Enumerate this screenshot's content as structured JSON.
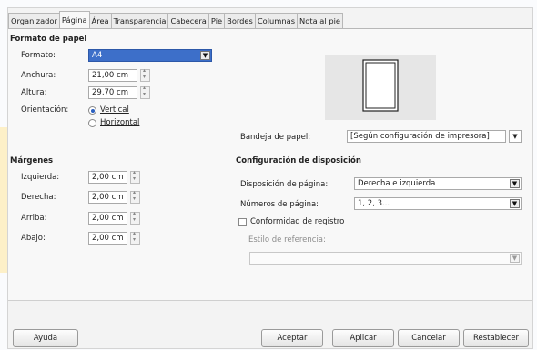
{
  "tabs": [
    "Organizador",
    "Página",
    "Área",
    "Transparencia",
    "Cabecera",
    "Pie",
    "Bordes",
    "Columnas",
    "Nota al pie"
  ],
  "active_tab": "Página",
  "paper": {
    "section_title": "Formato de papel",
    "format_label": "Formato:",
    "format_value": "A4",
    "width_label": "Anchura:",
    "width_value": "21,00 cm",
    "height_label": "Altura:",
    "height_value": "29,70 cm",
    "orientation_label": "Orientación:",
    "vertical_label": "Vertical",
    "horizontal_label": "Horizontal",
    "orientation_selected": "Vertical",
    "tray_label": "Bandeja de papel:",
    "tray_value": "[Según configuración de impresora]"
  },
  "margins": {
    "section_title": "Márgenes",
    "left_label": "Izquierda:",
    "left_value": "2,00 cm",
    "right_label": "Derecha:",
    "right_value": "2,00 cm",
    "top_label": "Arriba:",
    "top_value": "2,00 cm",
    "bottom_label": "Abajo:",
    "bottom_value": "2,00 cm"
  },
  "layout": {
    "section_title": "Configuración de disposición",
    "page_layout_label": "Disposición de página:",
    "page_layout_value": "Derecha e izquierda",
    "page_numbers_label": "Números de página:",
    "page_numbers_value": "1, 2, 3...",
    "register_label": "Conformidad de registro",
    "register_checked": false,
    "reference_style_label": "Estilo de referencia:",
    "reference_style_value": ""
  },
  "buttons": {
    "help": "Ayuda",
    "ok": "Aceptar",
    "apply": "Aplicar",
    "cancel": "Cancelar",
    "reset": "Restablecer"
  },
  "colors": {
    "selected_field": "#3d6fc9",
    "accent_stripe": "#fdf0c8"
  },
  "icons": [
    "page-preview-icon",
    "dropdown-arrow-icon",
    "spin-arrows-icon"
  ]
}
